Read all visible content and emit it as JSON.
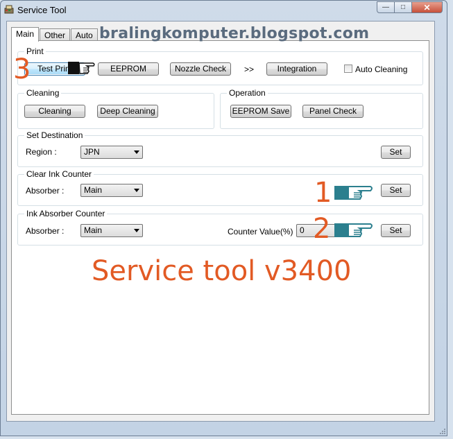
{
  "window": {
    "title": "Service Tool"
  },
  "tabs": [
    {
      "label": "Main"
    },
    {
      "label": "Other"
    },
    {
      "label": "Auto"
    }
  ],
  "print": {
    "group_label": "Print",
    "test_print": "Test Print",
    "eeprom": "EEPROM",
    "nozzle_check": "Nozzle Check",
    "arrows": ">>",
    "integration": "Integration",
    "auto_cleaning": "Auto Cleaning",
    "auto_cleaning_checked": false
  },
  "cleaning": {
    "group_label": "Cleaning",
    "cleaning": "Cleaning",
    "deep_cleaning": "Deep Cleaning"
  },
  "operation": {
    "group_label": "Operation",
    "eeprom_save": "EEPROM Save",
    "panel_check": "Panel Check"
  },
  "set_destination": {
    "group_label": "Set Destination",
    "region_label": "Region :",
    "region_value": "JPN",
    "set": "Set"
  },
  "clear_ink_counter": {
    "group_label": "Clear Ink Counter",
    "absorber_label": "Absorber :",
    "absorber_value": "Main",
    "set": "Set"
  },
  "ink_absorber_counter": {
    "group_label": "Ink Absorber Counter",
    "absorber_label": "Absorber :",
    "absorber_value": "Main",
    "counter_label": "Counter Value(%) :",
    "counter_value": "0",
    "set": "Set"
  },
  "overlay": {
    "blog": "bralingkomputer.blogspot.com",
    "caption": "Service tool v3400",
    "step1": "1",
    "step2": "2",
    "step3": "3"
  },
  "colors": {
    "annotation": "#e25a24",
    "hand": "#2b7f8e"
  }
}
